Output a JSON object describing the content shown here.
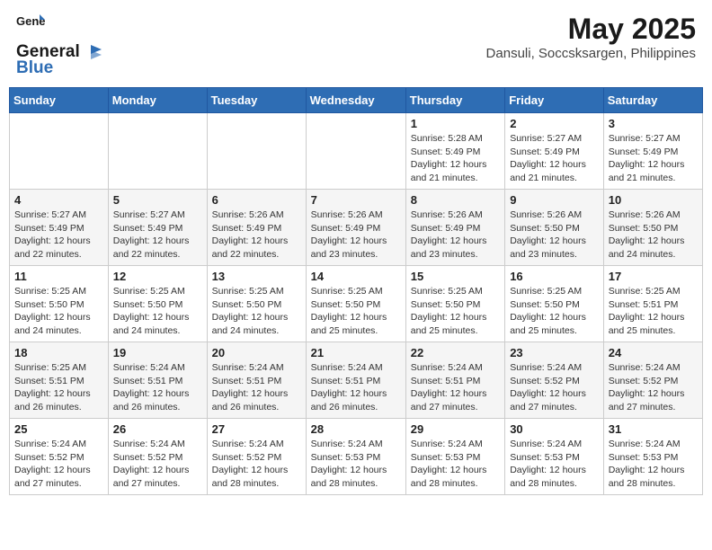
{
  "header": {
    "logo_general": "General",
    "logo_blue": "Blue",
    "title": "May 2025",
    "subtitle": "Dansuli, Soccsksargen, Philippines"
  },
  "calendar": {
    "columns": [
      "Sunday",
      "Monday",
      "Tuesday",
      "Wednesday",
      "Thursday",
      "Friday",
      "Saturday"
    ],
    "weeks": [
      [
        {
          "day": "",
          "info": ""
        },
        {
          "day": "",
          "info": ""
        },
        {
          "day": "",
          "info": ""
        },
        {
          "day": "",
          "info": ""
        },
        {
          "day": "1",
          "info": "Sunrise: 5:28 AM\nSunset: 5:49 PM\nDaylight: 12 hours\nand 21 minutes."
        },
        {
          "day": "2",
          "info": "Sunrise: 5:27 AM\nSunset: 5:49 PM\nDaylight: 12 hours\nand 21 minutes."
        },
        {
          "day": "3",
          "info": "Sunrise: 5:27 AM\nSunset: 5:49 PM\nDaylight: 12 hours\nand 21 minutes."
        }
      ],
      [
        {
          "day": "4",
          "info": "Sunrise: 5:27 AM\nSunset: 5:49 PM\nDaylight: 12 hours\nand 22 minutes."
        },
        {
          "day": "5",
          "info": "Sunrise: 5:27 AM\nSunset: 5:49 PM\nDaylight: 12 hours\nand 22 minutes."
        },
        {
          "day": "6",
          "info": "Sunrise: 5:26 AM\nSunset: 5:49 PM\nDaylight: 12 hours\nand 22 minutes."
        },
        {
          "day": "7",
          "info": "Sunrise: 5:26 AM\nSunset: 5:49 PM\nDaylight: 12 hours\nand 23 minutes."
        },
        {
          "day": "8",
          "info": "Sunrise: 5:26 AM\nSunset: 5:49 PM\nDaylight: 12 hours\nand 23 minutes."
        },
        {
          "day": "9",
          "info": "Sunrise: 5:26 AM\nSunset: 5:50 PM\nDaylight: 12 hours\nand 23 minutes."
        },
        {
          "day": "10",
          "info": "Sunrise: 5:26 AM\nSunset: 5:50 PM\nDaylight: 12 hours\nand 24 minutes."
        }
      ],
      [
        {
          "day": "11",
          "info": "Sunrise: 5:25 AM\nSunset: 5:50 PM\nDaylight: 12 hours\nand 24 minutes."
        },
        {
          "day": "12",
          "info": "Sunrise: 5:25 AM\nSunset: 5:50 PM\nDaylight: 12 hours\nand 24 minutes."
        },
        {
          "day": "13",
          "info": "Sunrise: 5:25 AM\nSunset: 5:50 PM\nDaylight: 12 hours\nand 24 minutes."
        },
        {
          "day": "14",
          "info": "Sunrise: 5:25 AM\nSunset: 5:50 PM\nDaylight: 12 hours\nand 25 minutes."
        },
        {
          "day": "15",
          "info": "Sunrise: 5:25 AM\nSunset: 5:50 PM\nDaylight: 12 hours\nand 25 minutes."
        },
        {
          "day": "16",
          "info": "Sunrise: 5:25 AM\nSunset: 5:50 PM\nDaylight: 12 hours\nand 25 minutes."
        },
        {
          "day": "17",
          "info": "Sunrise: 5:25 AM\nSunset: 5:51 PM\nDaylight: 12 hours\nand 25 minutes."
        }
      ],
      [
        {
          "day": "18",
          "info": "Sunrise: 5:25 AM\nSunset: 5:51 PM\nDaylight: 12 hours\nand 26 minutes."
        },
        {
          "day": "19",
          "info": "Sunrise: 5:24 AM\nSunset: 5:51 PM\nDaylight: 12 hours\nand 26 minutes."
        },
        {
          "day": "20",
          "info": "Sunrise: 5:24 AM\nSunset: 5:51 PM\nDaylight: 12 hours\nand 26 minutes."
        },
        {
          "day": "21",
          "info": "Sunrise: 5:24 AM\nSunset: 5:51 PM\nDaylight: 12 hours\nand 26 minutes."
        },
        {
          "day": "22",
          "info": "Sunrise: 5:24 AM\nSunset: 5:51 PM\nDaylight: 12 hours\nand 27 minutes."
        },
        {
          "day": "23",
          "info": "Sunrise: 5:24 AM\nSunset: 5:52 PM\nDaylight: 12 hours\nand 27 minutes."
        },
        {
          "day": "24",
          "info": "Sunrise: 5:24 AM\nSunset: 5:52 PM\nDaylight: 12 hours\nand 27 minutes."
        }
      ],
      [
        {
          "day": "25",
          "info": "Sunrise: 5:24 AM\nSunset: 5:52 PM\nDaylight: 12 hours\nand 27 minutes."
        },
        {
          "day": "26",
          "info": "Sunrise: 5:24 AM\nSunset: 5:52 PM\nDaylight: 12 hours\nand 27 minutes."
        },
        {
          "day": "27",
          "info": "Sunrise: 5:24 AM\nSunset: 5:52 PM\nDaylight: 12 hours\nand 28 minutes."
        },
        {
          "day": "28",
          "info": "Sunrise: 5:24 AM\nSunset: 5:53 PM\nDaylight: 12 hours\nand 28 minutes."
        },
        {
          "day": "29",
          "info": "Sunrise: 5:24 AM\nSunset: 5:53 PM\nDaylight: 12 hours\nand 28 minutes."
        },
        {
          "day": "30",
          "info": "Sunrise: 5:24 AM\nSunset: 5:53 PM\nDaylight: 12 hours\nand 28 minutes."
        },
        {
          "day": "31",
          "info": "Sunrise: 5:24 AM\nSunset: 5:53 PM\nDaylight: 12 hours\nand 28 minutes."
        }
      ]
    ]
  }
}
